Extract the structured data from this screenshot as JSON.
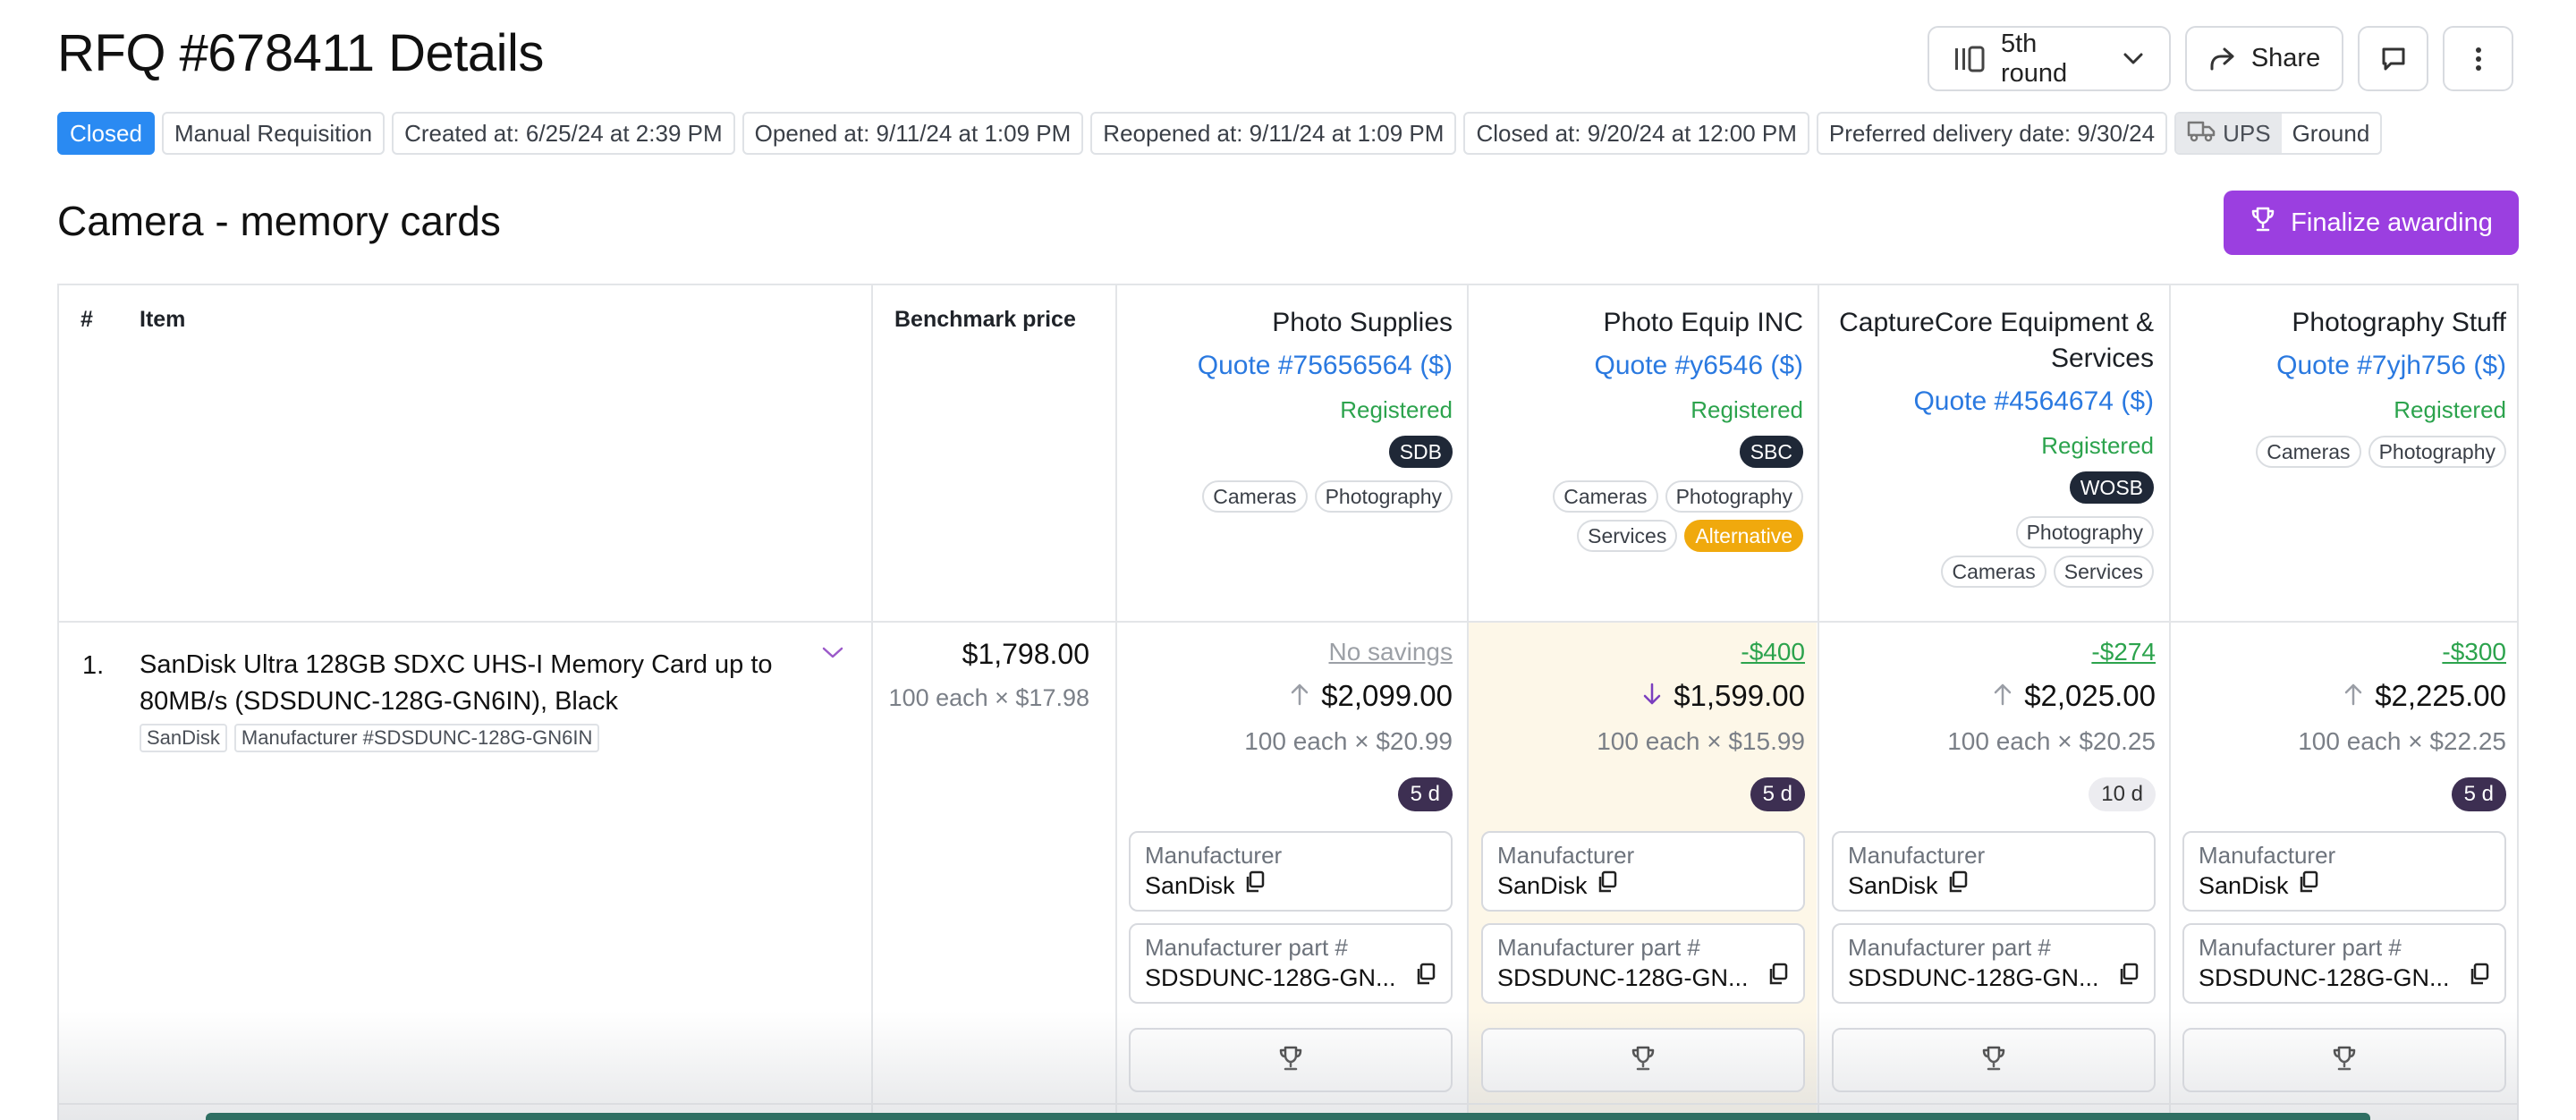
{
  "header": {
    "title": "RFQ #678411 Details",
    "round_label": "5th round",
    "share_label": "Share"
  },
  "tags": {
    "status": "Closed",
    "type": "Manual Requisition",
    "created": "Created at: 6/25/24 at 2:39 PM",
    "opened": "Opened at: 9/11/24 at 1:09 PM",
    "reopened": "Reopened at: 9/11/24 at 1:09 PM",
    "closed": "Closed at: 9/20/24 at 12:00 PM",
    "delivery": "Preferred delivery date: 9/30/24",
    "carrier": "UPS",
    "service": "Ground"
  },
  "section": {
    "title": "Camera - memory cards",
    "finalize_label": "Finalize awarding"
  },
  "table": {
    "col_num": "#",
    "col_item": "Item",
    "col_bench": "Benchmark price"
  },
  "suppliers": [
    {
      "name": "Photo Supplies",
      "quote": "Quote #75656564 ($)",
      "status": "Registered",
      "badge": "SDB",
      "chips": [
        "Cameras",
        "Photography"
      ]
    },
    {
      "name": "Photo Equip INC",
      "quote": "Quote #y6546 ($)",
      "status": "Registered",
      "badge": "SBC",
      "chips": [
        "Cameras",
        "Photography",
        "Services"
      ],
      "alt_chip": "Alternative"
    },
    {
      "name": "CaptureCore Equipment & Services",
      "quote": "Quote #4564674 ($)",
      "status": "Registered",
      "badge": "WOSB",
      "chips": [
        "Photography",
        "Cameras",
        "Services"
      ]
    },
    {
      "name": "Photography Stuff",
      "quote": "Quote #7yjh756 ($)",
      "status": "Registered",
      "chips": [
        "Cameras",
        "Photography"
      ]
    }
  ],
  "row": {
    "num": "1.",
    "name": "SanDisk Ultra 128GB SDXC UHS-I Memory Card up to 80MB/s (SDSDUNC-128G-GN6IN), Black",
    "tag_brand": "SanDisk",
    "tag_mfr": "Manufacturer #SDSDUNC-128G-GN6IN",
    "bench_price": "$1,798.00",
    "bench_unit": "100 each × $17.98"
  },
  "quotes": [
    {
      "savings": "No savings",
      "price": "$2,099.00",
      "direction": "up",
      "unit": "100 each × $20.99",
      "lead": "5 d",
      "mfr_label": "Manufacturer",
      "mfr": "SanDisk",
      "part_label": "Manufacturer part #",
      "part": "SDSDUNC-128G-GN..."
    },
    {
      "savings": "-$400",
      "price": "$1,599.00",
      "direction": "down",
      "unit": "100 each × $15.99",
      "lead": "5 d",
      "mfr_label": "Manufacturer",
      "mfr": "SanDisk",
      "part_label": "Manufacturer part #",
      "part": "SDSDUNC-128G-GN..."
    },
    {
      "savings": "-$274",
      "price": "$2,025.00",
      "direction": "up",
      "unit": "100 each × $20.25",
      "lead": "10 d",
      "mfr_label": "Manufacturer",
      "mfr": "SanDisk",
      "part_label": "Manufacturer part #",
      "part": "SDSDUNC-128G-GN..."
    },
    {
      "savings": "-$300",
      "price": "$2,225.00",
      "direction": "up",
      "unit": "100 each × $22.25",
      "lead": "5 d",
      "mfr_label": "Manufacturer",
      "mfr": "SanDisk",
      "part_label": "Manufacturer part #",
      "part": "SDSDUNC-128G-GN..."
    }
  ],
  "icons": {
    "round": "kanban-icon",
    "round_caret": "chevron-down-icon",
    "share": "share-arrow-icon",
    "comment": "comment-icon",
    "more": "more-vertical-icon",
    "carrier": "truck-icon",
    "finalize": "trophy-icon",
    "copy": "copy-icon",
    "award": "trophy-icon",
    "price_up": "arrow-up-icon",
    "price_down": "arrow-down-icon"
  },
  "colors": {
    "closed": "#2a8af2",
    "finalize": "#9b3fe0",
    "link": "#2a79e0",
    "registered": "#2ca34d",
    "savings": "#2ca34d",
    "alternative": "#f0a90d",
    "lead_dark": "#3d2f52",
    "highlight_col": "#fdf7e8"
  }
}
